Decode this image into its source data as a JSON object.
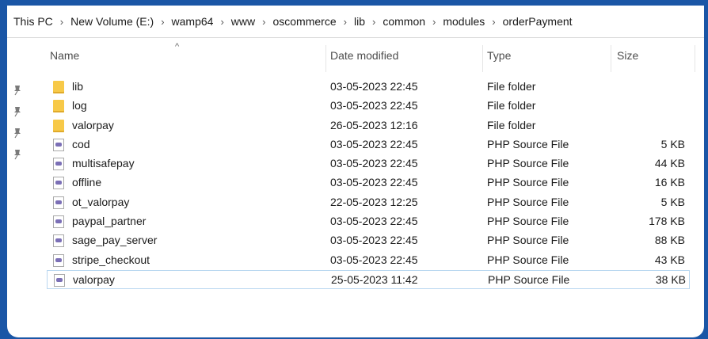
{
  "breadcrumb": [
    "This PC",
    "New Volume (E:)",
    "wamp64",
    "www",
    "oscommerce",
    "lib",
    "common",
    "modules",
    "orderPayment"
  ],
  "breadcrumb_separator": "›",
  "columns": {
    "name": "Name",
    "date_modified": "Date modified",
    "type": "Type",
    "size": "Size",
    "sort_indicator": "^"
  },
  "files": [
    {
      "name": "lib",
      "date": "03-05-2023 22:45",
      "type": "File folder",
      "size": "",
      "icon": "folder-icon"
    },
    {
      "name": "log",
      "date": "03-05-2023 22:45",
      "type": "File folder",
      "size": "",
      "icon": "folder-icon"
    },
    {
      "name": "valorpay",
      "date": "26-05-2023 12:16",
      "type": "File folder",
      "size": "",
      "icon": "folder-icon"
    },
    {
      "name": "cod",
      "date": "03-05-2023 22:45",
      "type": "PHP Source File",
      "size": "5 KB",
      "icon": "php-file-icon"
    },
    {
      "name": "multisafepay",
      "date": "03-05-2023 22:45",
      "type": "PHP Source File",
      "size": "44 KB",
      "icon": "php-file-icon"
    },
    {
      "name": "offline",
      "date": "03-05-2023 22:45",
      "type": "PHP Source File",
      "size": "16 KB",
      "icon": "php-file-icon"
    },
    {
      "name": "ot_valorpay",
      "date": "22-05-2023 12:25",
      "type": "PHP Source File",
      "size": "5 KB",
      "icon": "php-file-icon"
    },
    {
      "name": "paypal_partner",
      "date": "03-05-2023 22:45",
      "type": "PHP Source File",
      "size": "178 KB",
      "icon": "php-file-icon"
    },
    {
      "name": "sage_pay_server",
      "date": "03-05-2023 22:45",
      "type": "PHP Source File",
      "size": "88 KB",
      "icon": "php-file-icon"
    },
    {
      "name": "stripe_checkout",
      "date": "03-05-2023 22:45",
      "type": "PHP Source File",
      "size": "43 KB",
      "icon": "php-file-icon"
    },
    {
      "name": "valorpay",
      "date": "25-05-2023 11:42",
      "type": "PHP Source File",
      "size": "38 KB",
      "icon": "php-file-icon",
      "selected": true
    }
  ],
  "pinned_icons": [
    "pin-icon",
    "pin-icon",
    "pin-icon",
    "pin-icon"
  ],
  "colors": {
    "frame": "#1a56a6",
    "folder": "#f7c948",
    "selection_border": "#b9d7f0"
  }
}
